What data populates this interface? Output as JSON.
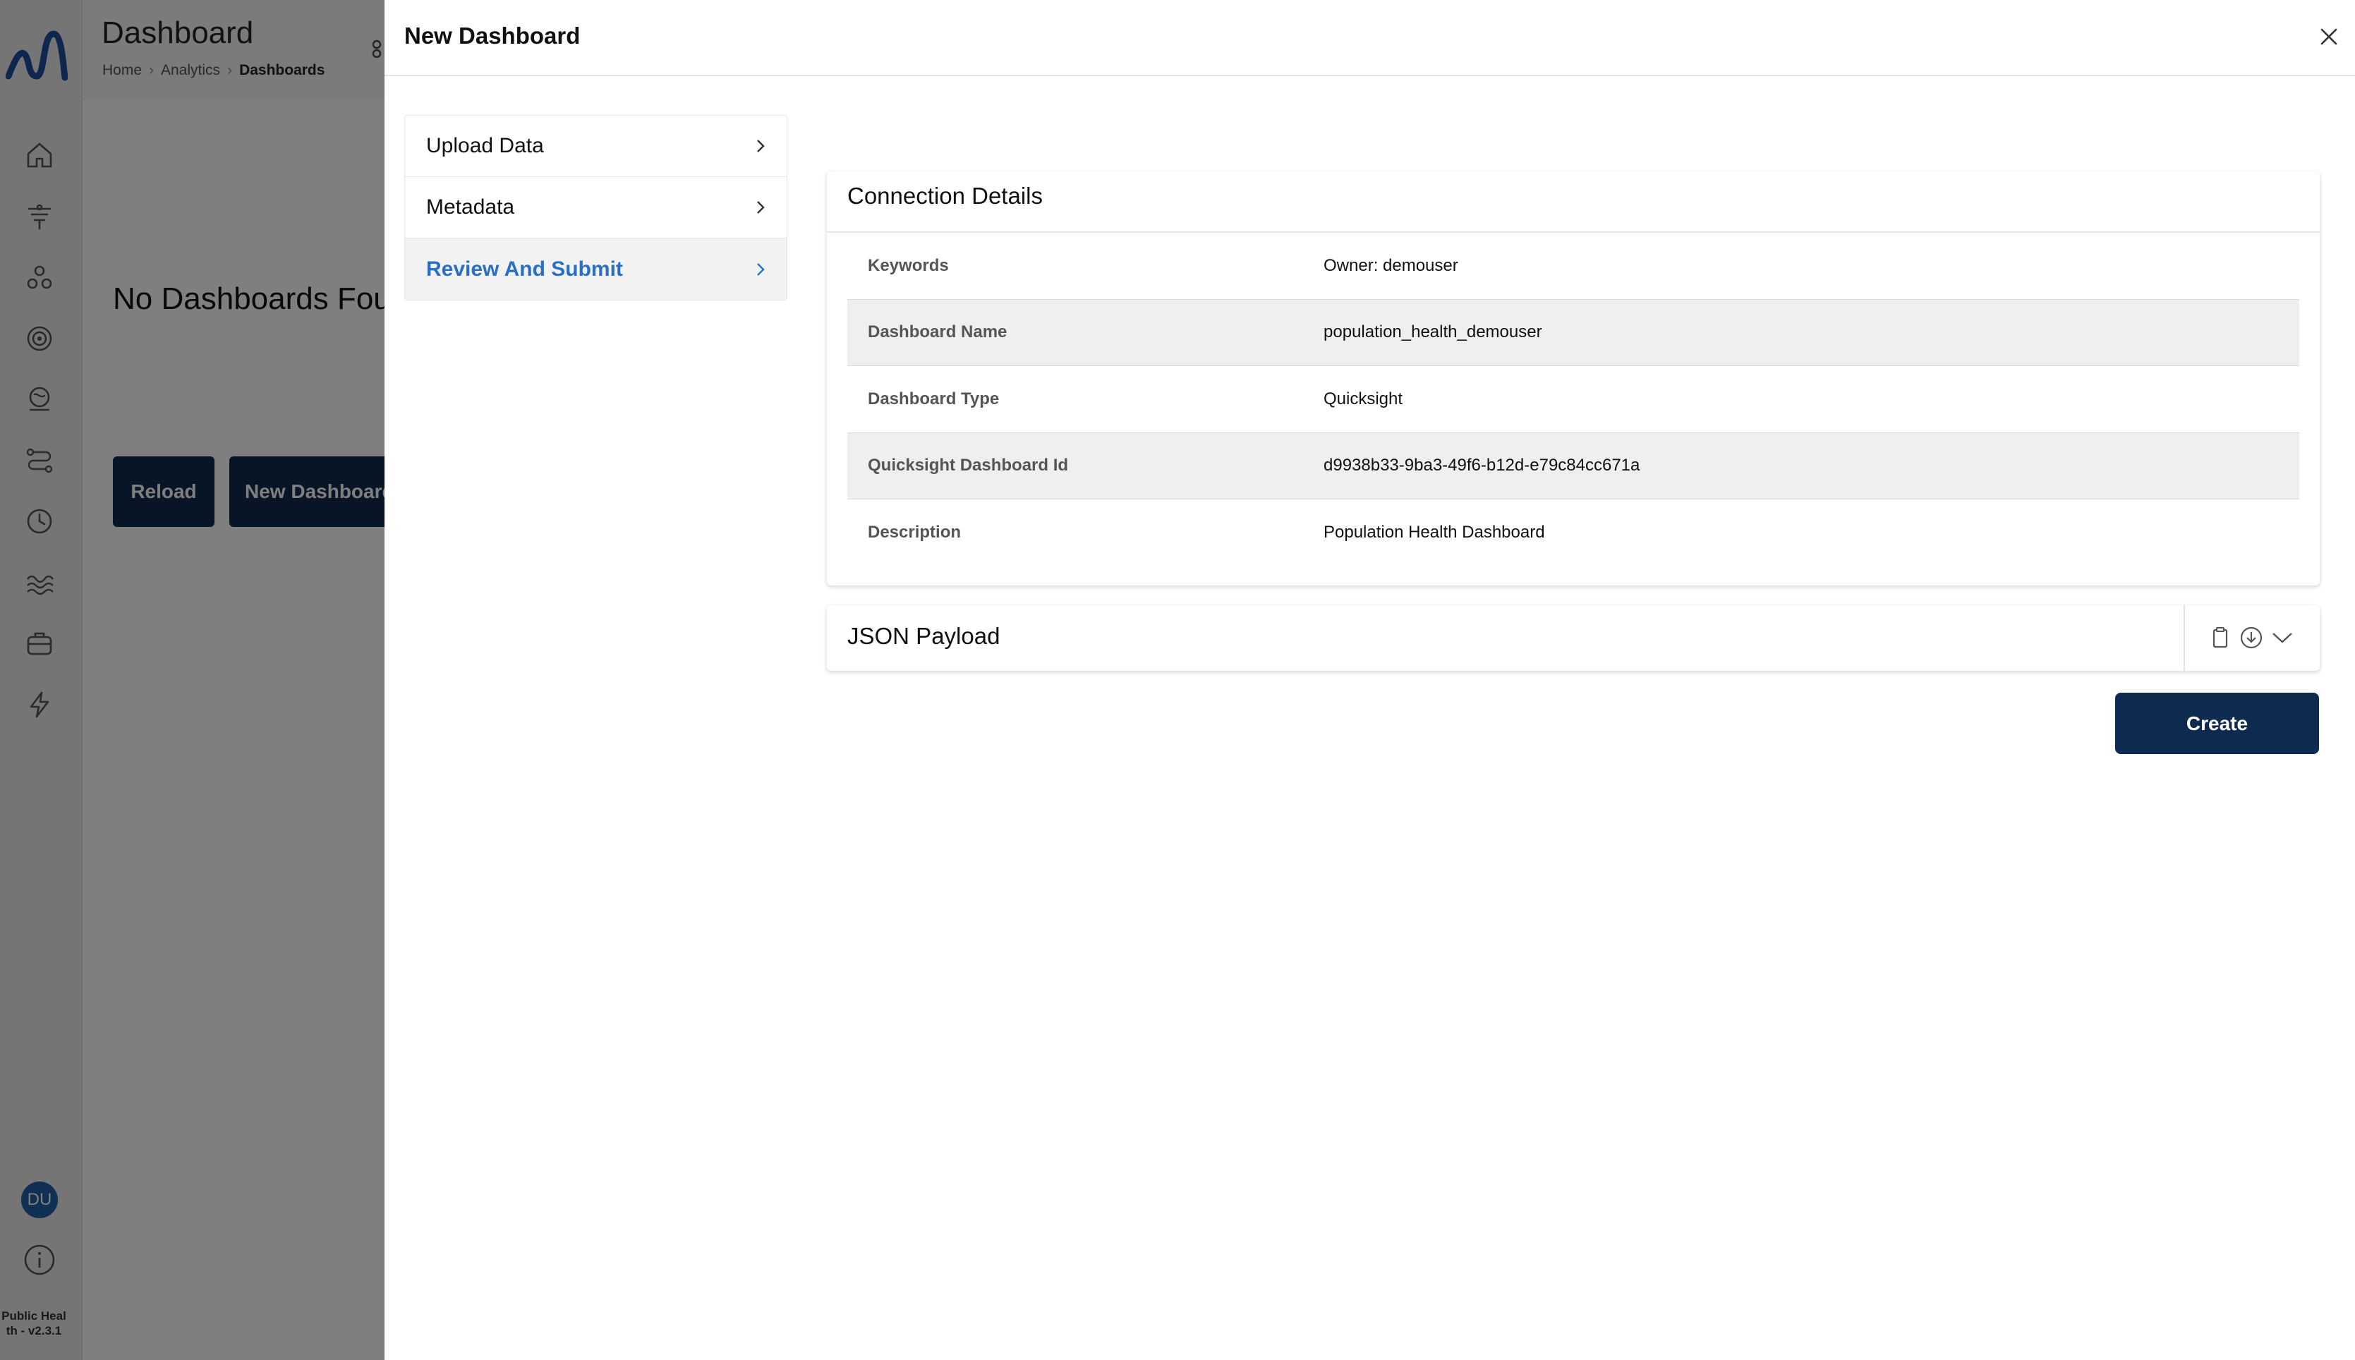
{
  "app": {
    "logo": "app-logo",
    "version_text": "Public Heal th - v2.3.1",
    "user_initials": "DU"
  },
  "rail": {
    "icons": [
      "home-icon",
      "filter-icon",
      "molecule-icon",
      "target-icon",
      "globe-icon",
      "workflow-icon",
      "clock-icon",
      "waves-icon",
      "toolbox-icon",
      "lightning-icon"
    ]
  },
  "page": {
    "title": "Dashboard",
    "breadcrumb": [
      "Home",
      "Analytics",
      "Dashboards"
    ],
    "empty_title": "No Dashboards Four",
    "reload_label": "Reload",
    "new_dashboard_label": "New Dashboard"
  },
  "drawer": {
    "title": "New Dashboard",
    "steps": [
      {
        "label": "Upload Data",
        "active": false
      },
      {
        "label": "Metadata",
        "active": false
      },
      {
        "label": "Review And Submit",
        "active": true
      }
    ],
    "connection": {
      "title": "Connection Details",
      "rows": [
        {
          "key": "Keywords",
          "value": "Owner: demouser"
        },
        {
          "key": "Dashboard Name",
          "value": "population_health_demouser"
        },
        {
          "key": "Dashboard Type",
          "value": "Quicksight"
        },
        {
          "key": "Quicksight Dashboard Id",
          "value": "d9938b33-9ba3-49f6-b12d-e79c84cc671a"
        },
        {
          "key": "Description",
          "value": "Population Health Dashboard"
        }
      ]
    },
    "json_payload": {
      "title": "JSON Payload",
      "icons": [
        "copy-icon",
        "download-icon",
        "chevron-down-icon"
      ]
    },
    "create_label": "Create"
  },
  "colors": {
    "primary": "#0e2a4e",
    "active_step": "#2a6fc4",
    "avatar": "#1f5fa6",
    "logo": "#1e4f9c"
  }
}
